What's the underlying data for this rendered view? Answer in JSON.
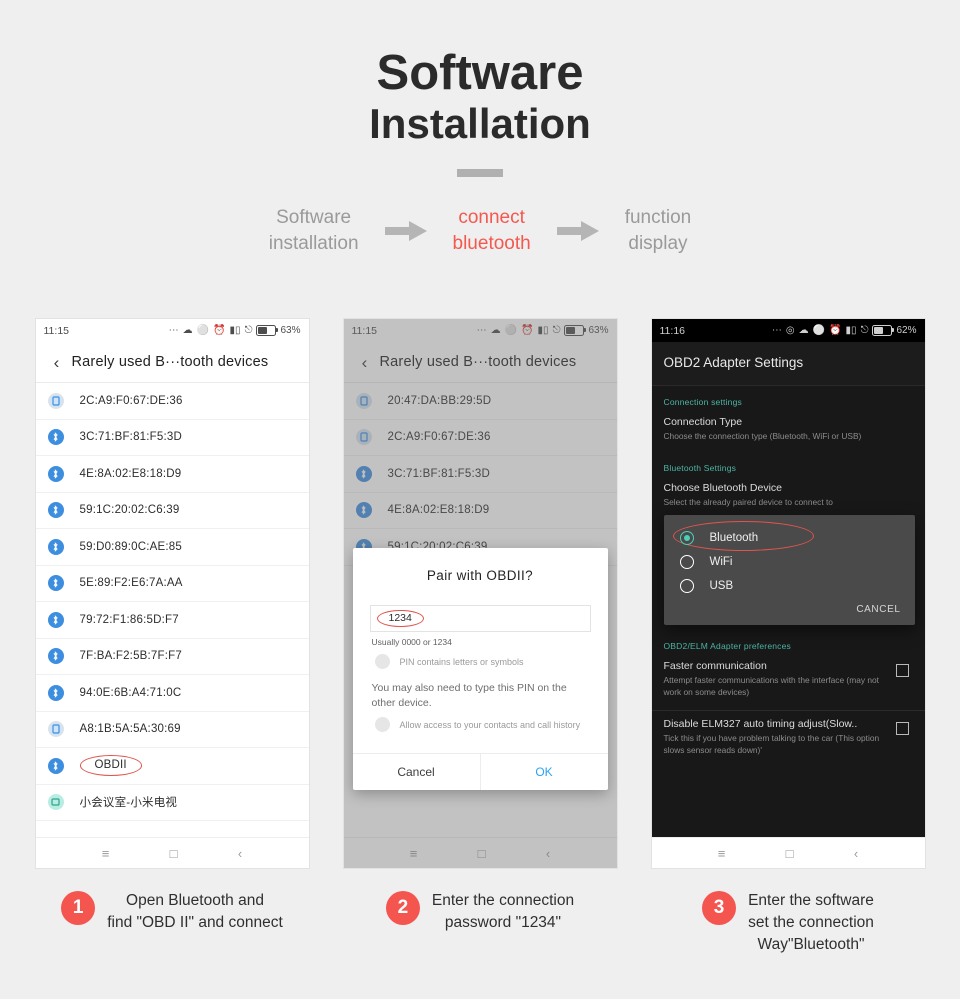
{
  "header": {
    "title_line1": "Software",
    "title_line2": "Installation"
  },
  "steps": [
    {
      "label": "Software\ninstallation",
      "active": false
    },
    {
      "label": "connect\nbluetooth",
      "active": true
    },
    {
      "label": "function\ndisplay",
      "active": false
    }
  ],
  "colors": {
    "accent_red": "#f4554f",
    "step_inactive": "#9a9a9a",
    "bt_blue": "#3e8ee0",
    "teal": "#4db6a4",
    "ok_blue": "#2aa3f0"
  },
  "phone1": {
    "status": {
      "clock": "11:15",
      "battery": "63%"
    },
    "appbar": {
      "back_icon": "chevron-left-icon",
      "title": "Rarely used B···tooth devices"
    },
    "devices": [
      {
        "name": "2C:A9:F0:67:DE:36",
        "icon": "phone-device-icon",
        "highlight": false
      },
      {
        "name": "3C:71:BF:81:F5:3D",
        "icon": "bluetooth-icon",
        "highlight": false
      },
      {
        "name": "4E:8A:02:E8:18:D9",
        "icon": "bluetooth-icon",
        "highlight": false
      },
      {
        "name": "59:1C:20:02:C6:39",
        "icon": "bluetooth-icon",
        "highlight": false
      },
      {
        "name": "59:D0:89:0C:AE:85",
        "icon": "bluetooth-icon",
        "highlight": false
      },
      {
        "name": "5E:89:F2:E6:7A:AA",
        "icon": "bluetooth-icon",
        "highlight": false
      },
      {
        "name": "79:72:F1:86:5D:F7",
        "icon": "bluetooth-icon",
        "highlight": false
      },
      {
        "name": "7F:BA:F2:5B:7F:F7",
        "icon": "bluetooth-icon",
        "highlight": false
      },
      {
        "name": "94:0E:6B:A4:71:0C",
        "icon": "bluetooth-icon",
        "highlight": false
      },
      {
        "name": "A8:1B:5A:5A:30:69",
        "icon": "phone-device-icon",
        "highlight": false
      },
      {
        "name": "OBDII",
        "icon": "bluetooth-icon",
        "highlight": true
      },
      {
        "name": "小会议室-小米电视",
        "icon": "tv-device-icon",
        "highlight": false
      }
    ],
    "navbar": {
      "menu": "≡",
      "home": "□",
      "back": "‹"
    }
  },
  "phone2": {
    "status": {
      "clock": "11:15",
      "battery": "63%"
    },
    "appbar": {
      "back_icon": "chevron-left-icon",
      "title": "Rarely used B···tooth devices"
    },
    "devices": [
      {
        "name": "20:47:DA:BB:29:5D",
        "icon": "phone-device-icon"
      },
      {
        "name": "2C:A9:F0:67:DE:36",
        "icon": "phone-device-icon"
      },
      {
        "name": "3C:71:BF:81:F5:3D",
        "icon": "bluetooth-icon"
      },
      {
        "name": "4E:8A:02:E8:18:D9",
        "icon": "bluetooth-icon"
      },
      {
        "name": "59:1C:20:02:C6:39",
        "icon": "bluetooth-icon"
      }
    ],
    "dialog": {
      "title": "Pair with OBDII?",
      "pin_value": "1234",
      "pin_hint": "Usually 0000 or 1234",
      "checkbox1": "PIN contains letters or symbols",
      "note": "You may also need to type this\nPIN on the other device.",
      "checkbox2": "Allow access to your contacts\nand call history",
      "cancel": "Cancel",
      "ok": "OK"
    },
    "navbar": {
      "menu": "≡",
      "home": "□",
      "back": "‹"
    }
  },
  "phone3": {
    "status": {
      "clock": "11:16",
      "battery": "62%"
    },
    "app_title": "OBD2 Adapter Settings",
    "sections": [
      {
        "heading": "Connection settings",
        "items": [
          {
            "title": "Connection Type",
            "subtitle": "Choose the connection type (Bluetooth, WiFi or USB)",
            "checkbox": false
          }
        ]
      },
      {
        "heading": "Bluetooth Settings",
        "items": [
          {
            "title": "Choose Bluetooth Device",
            "subtitle": "Select the already paired device to connect to",
            "checkbox": false
          }
        ]
      },
      {
        "heading": "OBD2/ELM Adapter preferences",
        "items": [
          {
            "title": "Faster communication",
            "subtitle": "Attempt faster communications with the\ninterface (may not work on some devices)",
            "checkbox": true
          },
          {
            "title": "Disable ELM327 auto timing adjust(Slow..",
            "subtitle": "Tick this if you have problem talking to the car\n(This option slows sensor reads down)'",
            "checkbox": true
          }
        ]
      }
    ],
    "dialog": {
      "options": [
        {
          "label": "Bluetooth",
          "selected": true,
          "highlight": true
        },
        {
          "label": "WiFi",
          "selected": false,
          "highlight": false
        },
        {
          "label": "USB",
          "selected": false,
          "highlight": false
        }
      ],
      "cancel": "CANCEL"
    },
    "navbar": {
      "menu": "≡",
      "home": "□",
      "back": "‹"
    }
  },
  "captions": [
    {
      "number": "1",
      "text": "Open Bluetooth and\nfind \"OBD II\" and connect"
    },
    {
      "number": "2",
      "text": "Enter the connection\npassword \"1234\""
    },
    {
      "number": "3",
      "text": "Enter the software\nset the connection\nWay\"Bluetooth\""
    }
  ]
}
